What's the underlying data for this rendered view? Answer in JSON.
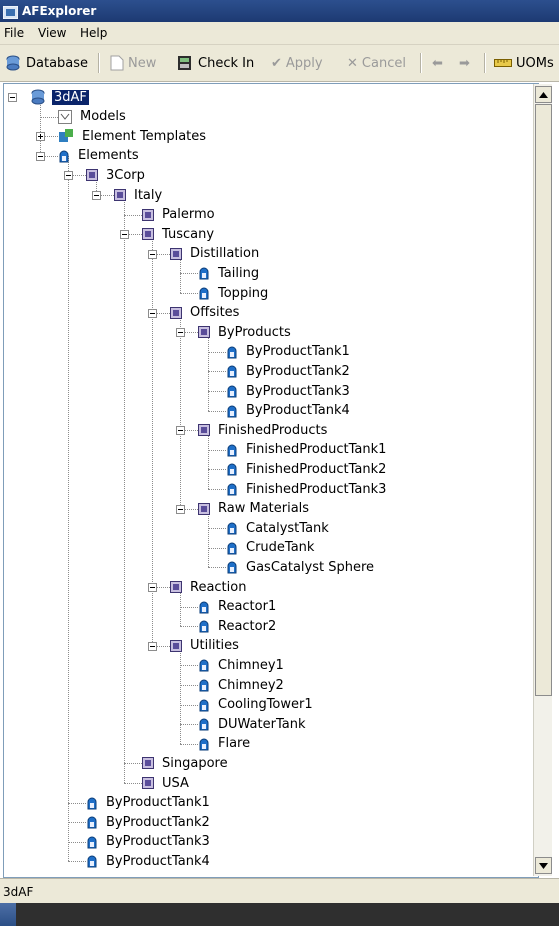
{
  "window": {
    "title": "AFExplorer"
  },
  "menu": {
    "items": [
      "File",
      "View",
      "Help"
    ]
  },
  "toolbar": {
    "database": "Database",
    "new": "New",
    "check_in": "Check In",
    "apply": "Apply",
    "cancel": "Cancel",
    "uoms": "UOMs"
  },
  "tree": {
    "nodes": [
      {
        "label": "3dAF",
        "icon": "database-icon",
        "selected": true
      },
      {
        "label": "Models",
        "icon": "model-icon"
      },
      {
        "label": "Element Templates",
        "icon": "template-icon"
      },
      {
        "label": "Elements",
        "icon": "element-icon"
      },
      {
        "label": "3Corp",
        "icon": "group-icon"
      },
      {
        "label": "Italy",
        "icon": "group-icon"
      },
      {
        "label": "Palermo",
        "icon": "group-icon"
      },
      {
        "label": "Tuscany",
        "icon": "group-icon"
      },
      {
        "label": "Distillation",
        "icon": "group-icon"
      },
      {
        "label": "Tailing",
        "icon": "element-icon"
      },
      {
        "label": "Topping",
        "icon": "element-icon"
      },
      {
        "label": "Offsites",
        "icon": "group-icon"
      },
      {
        "label": "ByProducts",
        "icon": "group-icon"
      },
      {
        "label": "ByProductTank1",
        "icon": "element-icon"
      },
      {
        "label": "ByProductTank2",
        "icon": "element-icon"
      },
      {
        "label": "ByProductTank3",
        "icon": "element-icon"
      },
      {
        "label": "ByProductTank4",
        "icon": "element-icon"
      },
      {
        "label": "FinishedProducts",
        "icon": "group-icon"
      },
      {
        "label": "FinishedProductTank1",
        "icon": "element-icon"
      },
      {
        "label": "FinishedProductTank2",
        "icon": "element-icon"
      },
      {
        "label": "FinishedProductTank3",
        "icon": "element-icon"
      },
      {
        "label": "Raw Materials",
        "icon": "group-icon"
      },
      {
        "label": "CatalystTank",
        "icon": "element-icon"
      },
      {
        "label": "CrudeTank",
        "icon": "element-icon"
      },
      {
        "label": "GasCatalyst Sphere",
        "icon": "element-icon"
      },
      {
        "label": "Reaction",
        "icon": "group-icon"
      },
      {
        "label": "Reactor1",
        "icon": "element-icon"
      },
      {
        "label": "Reactor2",
        "icon": "element-icon"
      },
      {
        "label": "Utilities",
        "icon": "group-icon"
      },
      {
        "label": "Chimney1",
        "icon": "element-icon"
      },
      {
        "label": "Chimney2",
        "icon": "element-icon"
      },
      {
        "label": "CoolingTower1",
        "icon": "element-icon"
      },
      {
        "label": "DUWaterTank",
        "icon": "element-icon"
      },
      {
        "label": "Flare",
        "icon": "element-icon"
      },
      {
        "label": "Singapore",
        "icon": "group-icon"
      },
      {
        "label": "USA",
        "icon": "group-icon"
      },
      {
        "label": "ByProductTank1",
        "icon": "element-icon"
      },
      {
        "label": "ByProductTank2",
        "icon": "element-icon"
      },
      {
        "label": "ByProductTank3",
        "icon": "element-icon"
      },
      {
        "label": "ByProductTank4",
        "icon": "element-icon"
      }
    ]
  },
  "status": {
    "text": "3dAF"
  },
  "colors": {
    "selection": "#0a246a",
    "titlebar": "#2c4f8e",
    "chrome": "#ece9d8"
  }
}
